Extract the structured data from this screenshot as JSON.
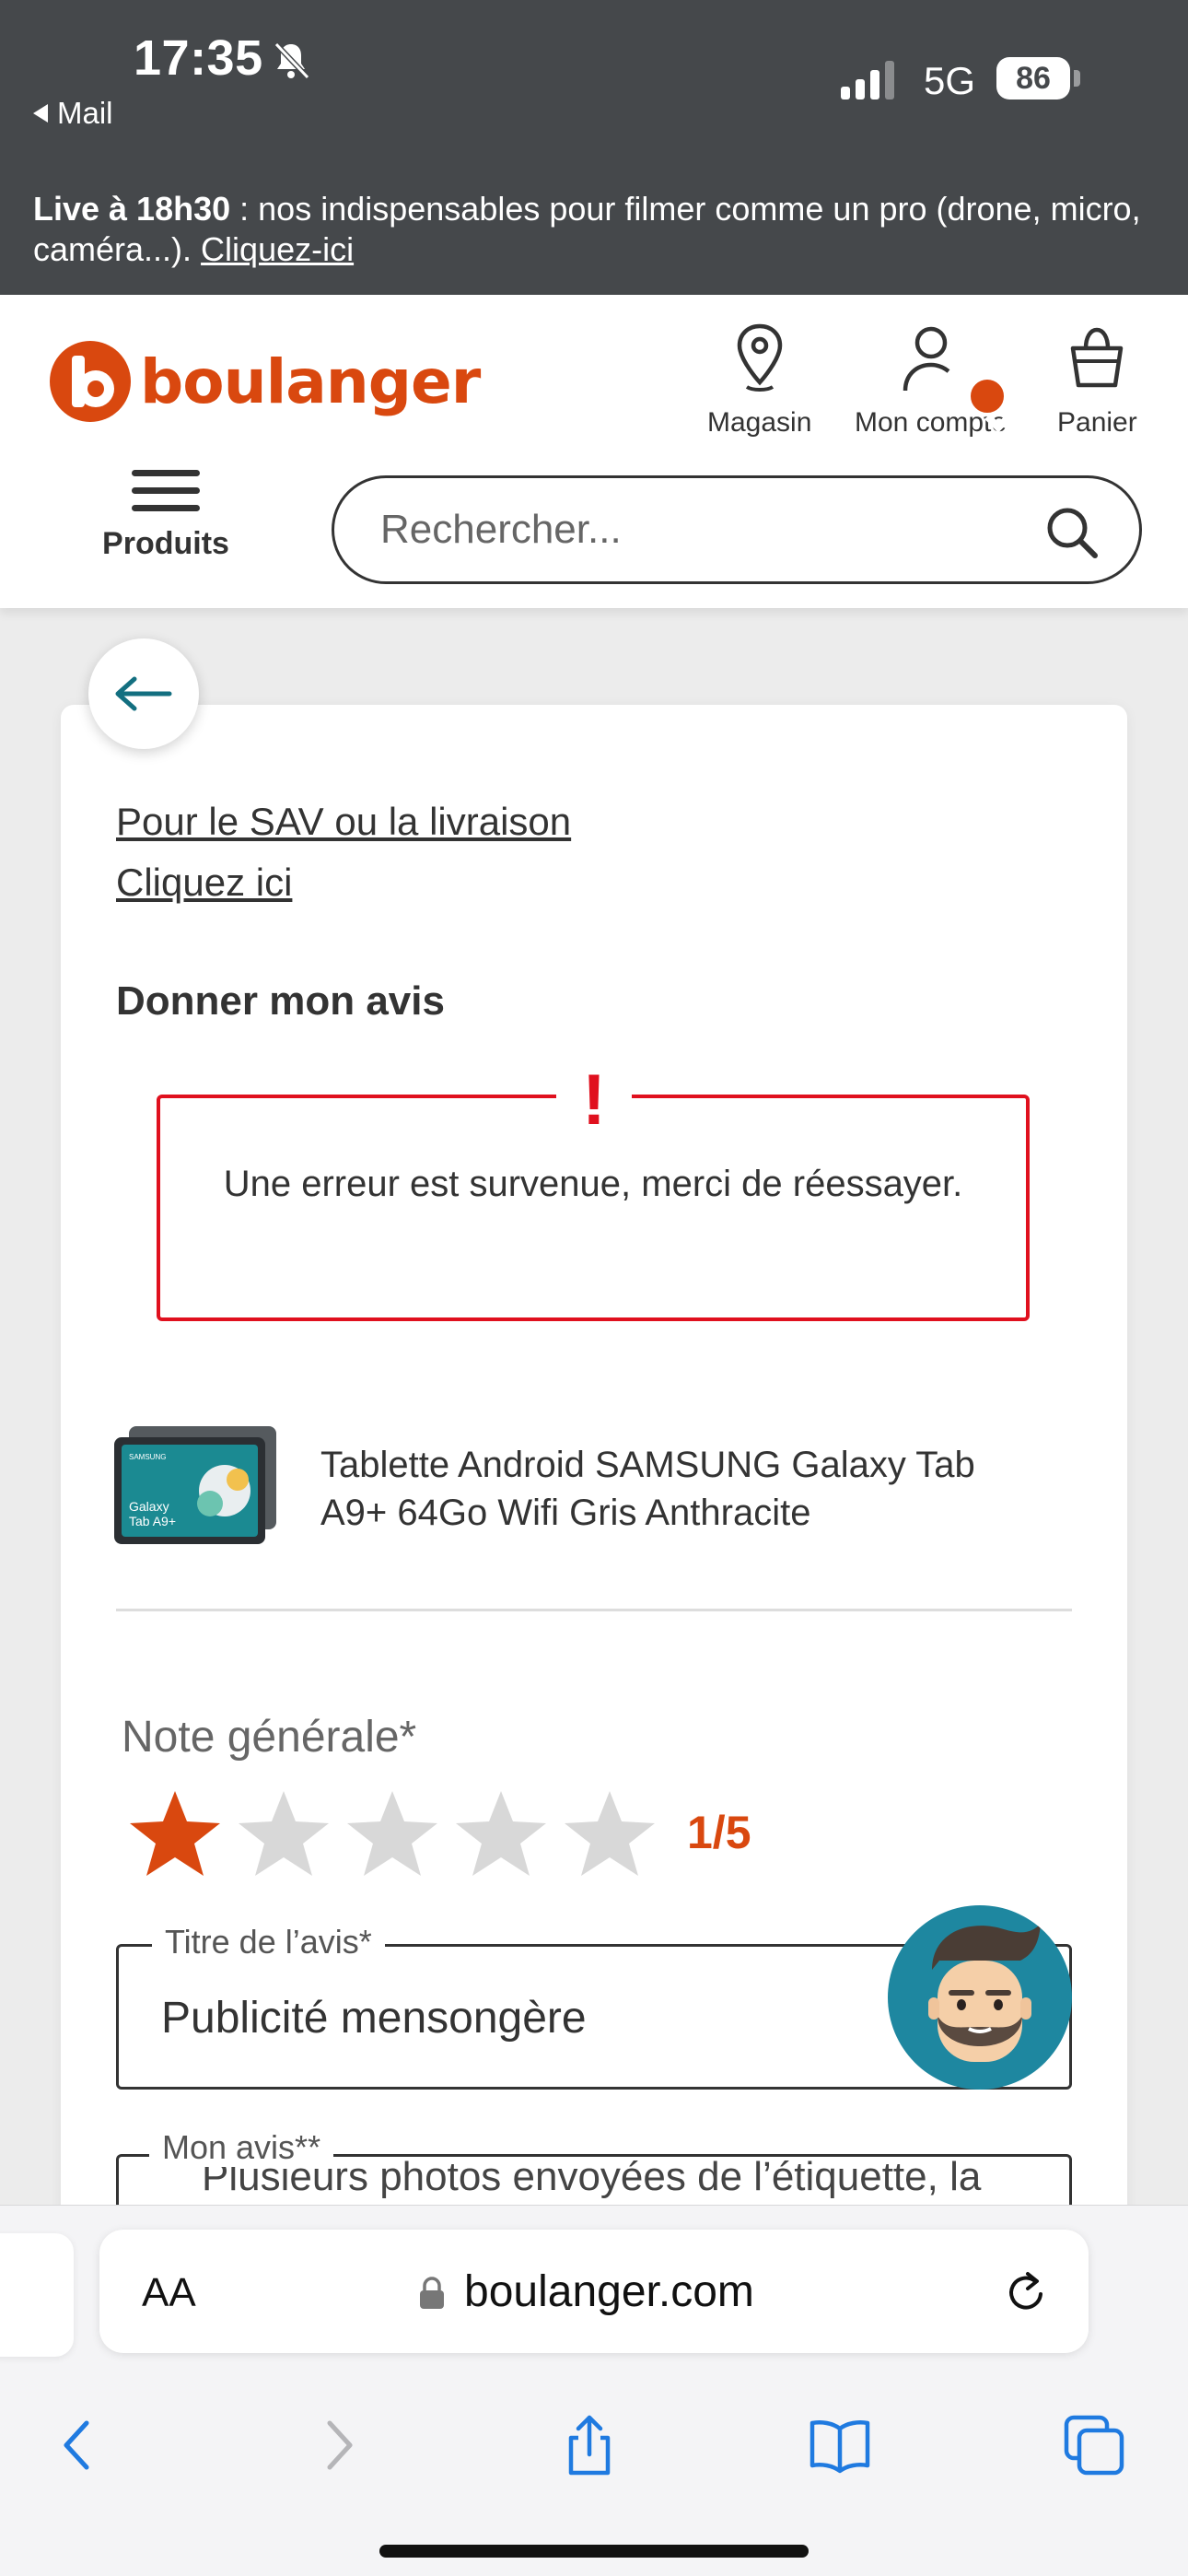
{
  "status_bar": {
    "time": "17:35",
    "back_app": "Mail",
    "network": "5G",
    "battery": "86"
  },
  "banner": {
    "bold": "Live à 18h30",
    "text": " : nos indispensables pour filmer comme un pro (drone, micro, caméra...). ",
    "link": "Cliquez-ici"
  },
  "header": {
    "logo_text": "boulanger",
    "store_label": "Magasin",
    "account_label": "Mon compte",
    "cart_label": "Panier",
    "menu_label": "Produits",
    "search_placeholder": "Rechercher..."
  },
  "content": {
    "link_sav": "Pour le SAV ou la livraison",
    "link_click": "Cliquez ici",
    "section_title": "Donner mon avis",
    "error_message": "Une erreur est survenue, merci de réessayer.",
    "product_name": "Tablette Android SAMSUNG Galaxy Tab A9+ 64Go Wifi Gris Anthracite",
    "product_image_text": [
      "SAMSUNG",
      "Galaxy",
      "Tab A9+"
    ],
    "rating_label": "Note générale*",
    "rating_value": "1/5",
    "rating": {
      "value": 1,
      "max": 5
    },
    "title_field": {
      "legend": "Titre de l’avis*",
      "value": "Publicité mensongère"
    },
    "review_field": {
      "legend": "Mon avis**",
      "value": "Plusieurs photos envoyées de l’étiquette, la participation et rejeté car"
    }
  },
  "browser": {
    "aa_label": "AA",
    "url": "boulanger.com"
  },
  "colors": {
    "brand": "#d9480f",
    "error": "#e0101e",
    "status_bg": "#45484b",
    "ios_blue": "#1f7ae0"
  }
}
